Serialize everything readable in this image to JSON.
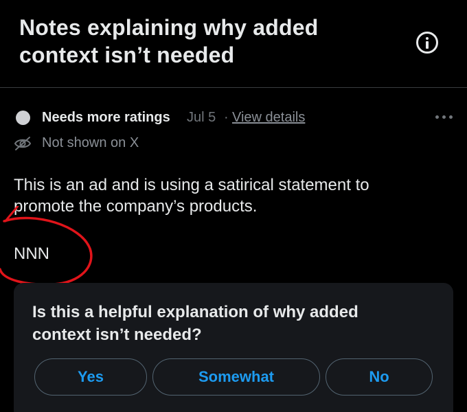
{
  "header": {
    "title": "Notes explaining why added context isn’t needed",
    "info_icon": "info-circle-icon"
  },
  "note": {
    "status_label": "Needs more ratings",
    "date": "Jul 5",
    "separator": "·",
    "view_details_label": "View details",
    "visibility_label": "Not shown on X",
    "body": "This is an ad and is using a satirical statement to promote the company’s products.",
    "signature": "NNN",
    "icons": {
      "status": "status-dot-icon",
      "visibility": "eye-off-icon",
      "more": "more-horizontal-icon"
    }
  },
  "rating": {
    "question": "Is this a helpful explanation of why added context isn’t needed?",
    "options": [
      "Yes",
      "Somewhat",
      "No"
    ]
  },
  "colors": {
    "background": "#000000",
    "text": "#e7e9ea",
    "muted": "#71767b",
    "accent": "#1d9bf0",
    "card": "#16181c",
    "annotation": "#e0141a"
  }
}
